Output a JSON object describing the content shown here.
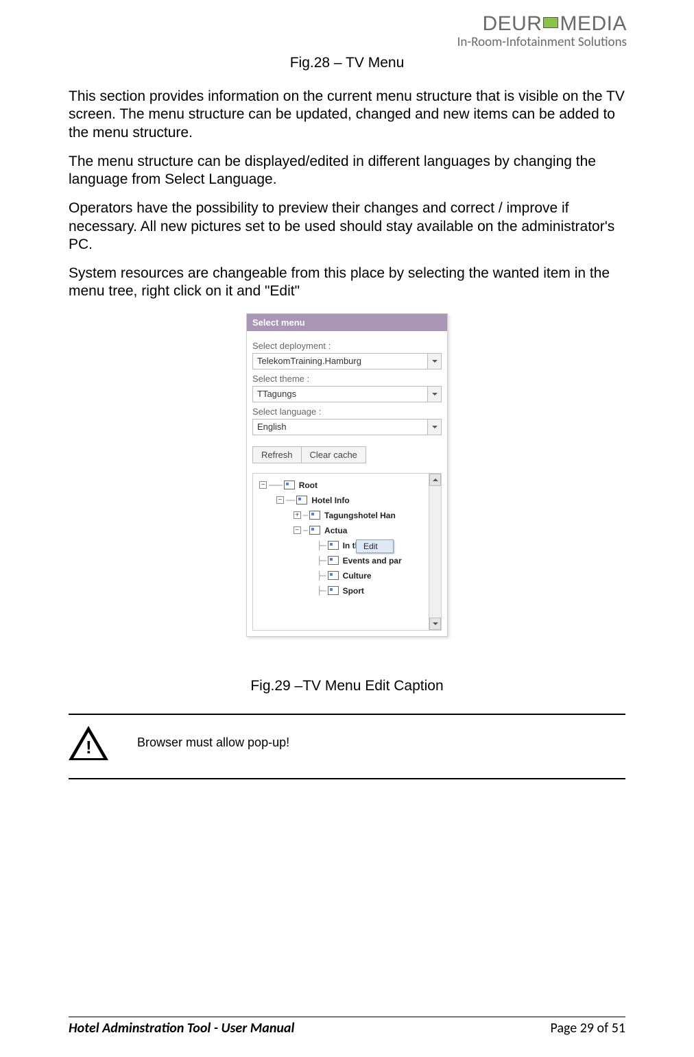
{
  "header": {
    "logo_prefix": "DEUR",
    "logo_suffix": "MEDIA",
    "tagline": "In-Room-Infotainment Solutions"
  },
  "captions": {
    "fig28": "Fig.28 – TV Menu",
    "fig29": "Fig.29 –TV Menu Edit Caption"
  },
  "paragraphs": {
    "p1": "This section provides information on the current menu structure that is visible on the TV screen. The menu structure can be updated, changed and new items can be added to the menu structure.",
    "p2": "The menu structure can be displayed/edited in different languages by changing the language from Select Language.",
    "p3": "Operators have the possibility to preview their changes and correct / improve if necessary. All new pictures set to be used should stay available on the administrator's PC.",
    "p4": "System resources are changeable from this place by selecting the wanted item in the menu tree, right click on it and \"Edit\""
  },
  "panel": {
    "title": "Select menu",
    "labels": {
      "deployment": "Select deployment :",
      "theme": "Select theme :",
      "language": "Select language :"
    },
    "values": {
      "deployment": "TelekomTraining.Hamburg",
      "theme": "TTagungs",
      "language": "English"
    },
    "buttons": {
      "refresh": "Refresh",
      "clear": "Clear cache"
    },
    "tree": {
      "root": "Root",
      "hotel_info": "Hotel Info",
      "tagungshotel": "Tagungshotel Han",
      "actual": "Actua",
      "in_hotel": "In the notel",
      "events": "Events and par",
      "culture": "Culture",
      "sport": "Sport"
    },
    "context_menu": "Edit"
  },
  "note": "Browser must allow pop-up!",
  "footer": {
    "left": "Hotel Adminstration Tool - User Manual",
    "right": "Page 29 of 51"
  }
}
